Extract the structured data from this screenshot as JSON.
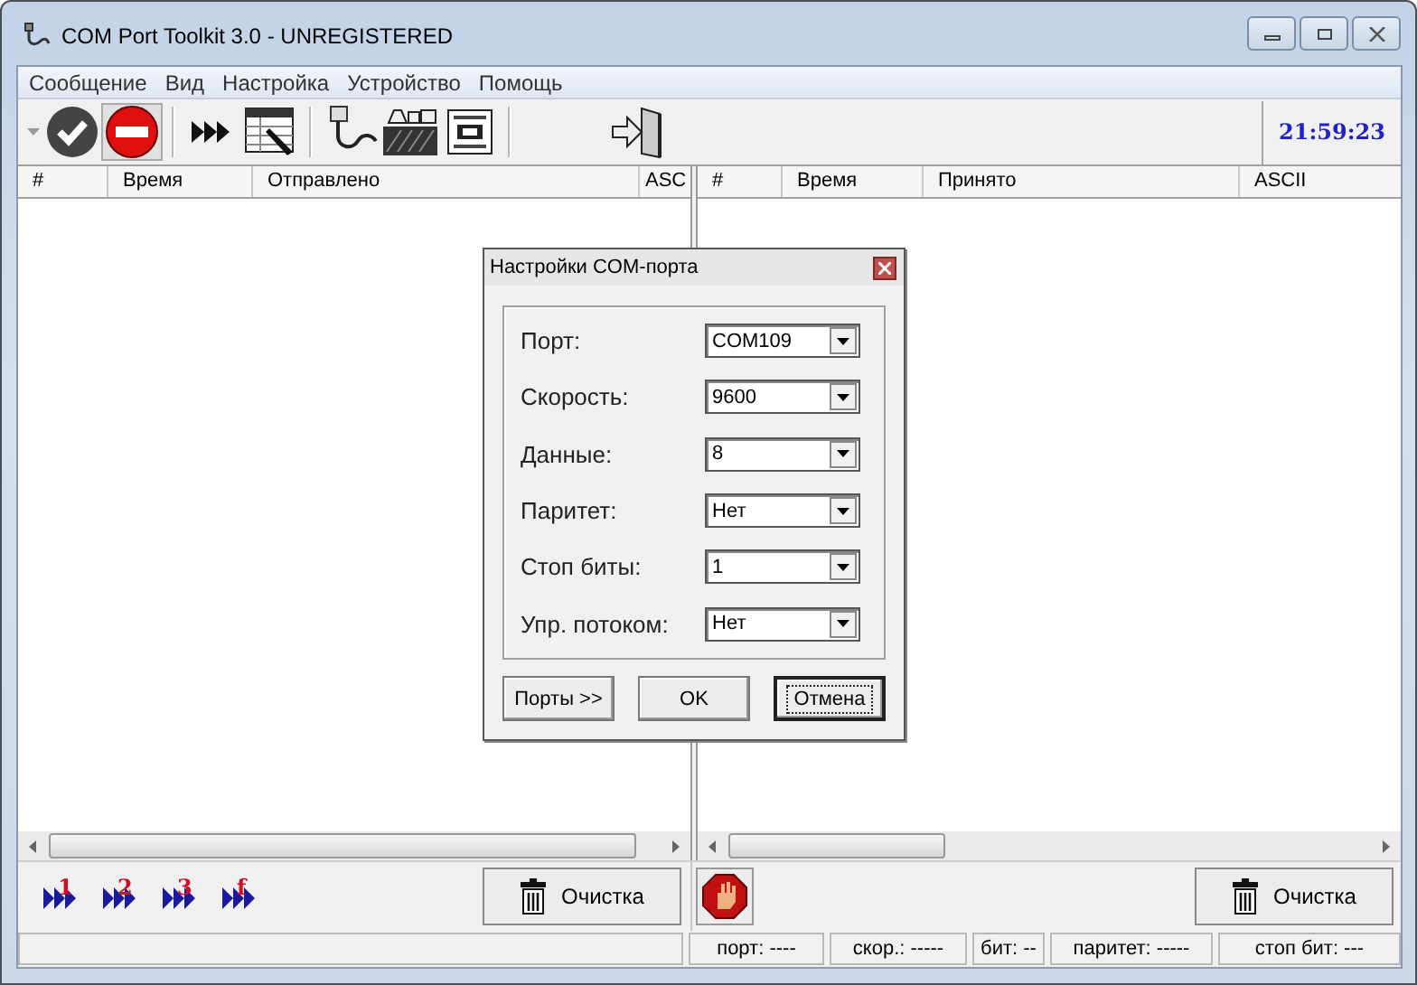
{
  "window": {
    "title": "COM Port Toolkit 3.0 - UNREGISTERED"
  },
  "menu": [
    "Сообщение",
    "Вид",
    "Настройка",
    "Устройство",
    "Помощь"
  ],
  "toolbar": {
    "buttons": [
      {
        "kind": "dropdown",
        "pressed": false
      },
      {
        "kind": "connect",
        "pressed": false
      },
      {
        "kind": "disconnect",
        "pressed": true
      },
      {
        "kind": "sep"
      },
      {
        "kind": "send",
        "pressed": false
      },
      {
        "kind": "table",
        "pressed": false
      },
      {
        "kind": "sep"
      },
      {
        "kind": "cable",
        "pressed": false
      },
      {
        "kind": "tools",
        "pressed": false
      },
      {
        "kind": "hex",
        "pressed": false
      },
      {
        "kind": "sep"
      },
      {
        "kind": "exit",
        "pressed": false
      }
    ],
    "clock": "21:59:23"
  },
  "sent_table": {
    "columns": [
      "#",
      "Время",
      "Отправлено",
      "ASC"
    ]
  },
  "received_table": {
    "columns": [
      "#",
      "Время",
      "Принято",
      "ASCII"
    ]
  },
  "macros": [
    {
      "label": "1"
    },
    {
      "label": "2"
    },
    {
      "label": "3"
    },
    {
      "label": "f"
    }
  ],
  "left_clear_button": "Очистка",
  "right_clear_button": "Очистка",
  "status_bar": [
    "порт: ----",
    "скор.: -----",
    "бит: --",
    "паритет: -----",
    "стоп бит: ---"
  ],
  "dialog": {
    "title": "Настройки COM-порта",
    "fields": [
      {
        "label": "Порт:",
        "value": "COM109"
      },
      {
        "label": "Скорость:",
        "value": "9600"
      },
      {
        "label": "Данные:",
        "value": "8"
      },
      {
        "label": "Паритет:",
        "value": "Нет"
      },
      {
        "label": "Стоп биты:",
        "value": "1"
      },
      {
        "label": "Упр. потоком:",
        "value": "Нет"
      }
    ],
    "buttons": [
      {
        "label": "Порты >>",
        "focused": false
      },
      {
        "label": "OK",
        "focused": false
      },
      {
        "label": "Отмена",
        "focused": true
      }
    ]
  }
}
